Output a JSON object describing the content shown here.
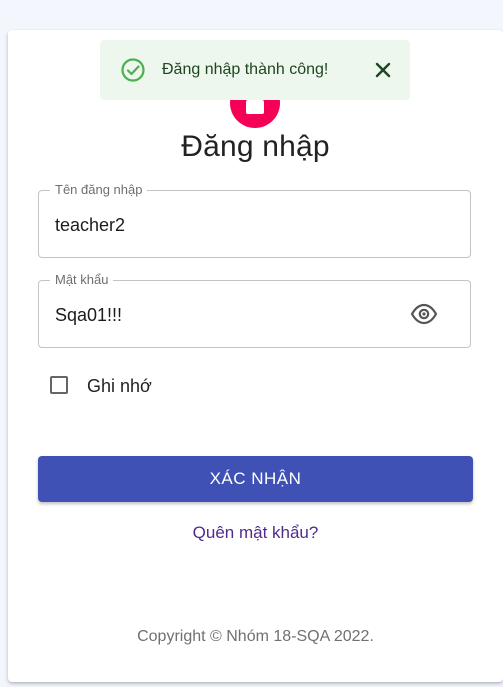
{
  "toast": {
    "message": "Đăng nhập thành công!",
    "status_icon": "check-circle-icon",
    "close_icon": "close-icon",
    "color": "#2e7d32",
    "background": "#edf7ed"
  },
  "avatar": {
    "icon": "lock-icon",
    "color": "#f50057"
  },
  "form": {
    "title": "Đăng nhập",
    "username": {
      "label": "Tên đăng nhập",
      "value": "teacher2"
    },
    "password": {
      "label": "Mật khẩu",
      "value": "Sqa01!!!",
      "toggle_icon": "eye-icon"
    },
    "remember": {
      "label": "Ghi nhớ",
      "checked": false
    },
    "submit_label": "XÁC NHẬN",
    "forgot_link": "Quên mật khẩu?",
    "accent_color": "#3f51b5"
  },
  "footer": {
    "copyright": "Copyright © Nhóm 18-SQA 2022."
  }
}
